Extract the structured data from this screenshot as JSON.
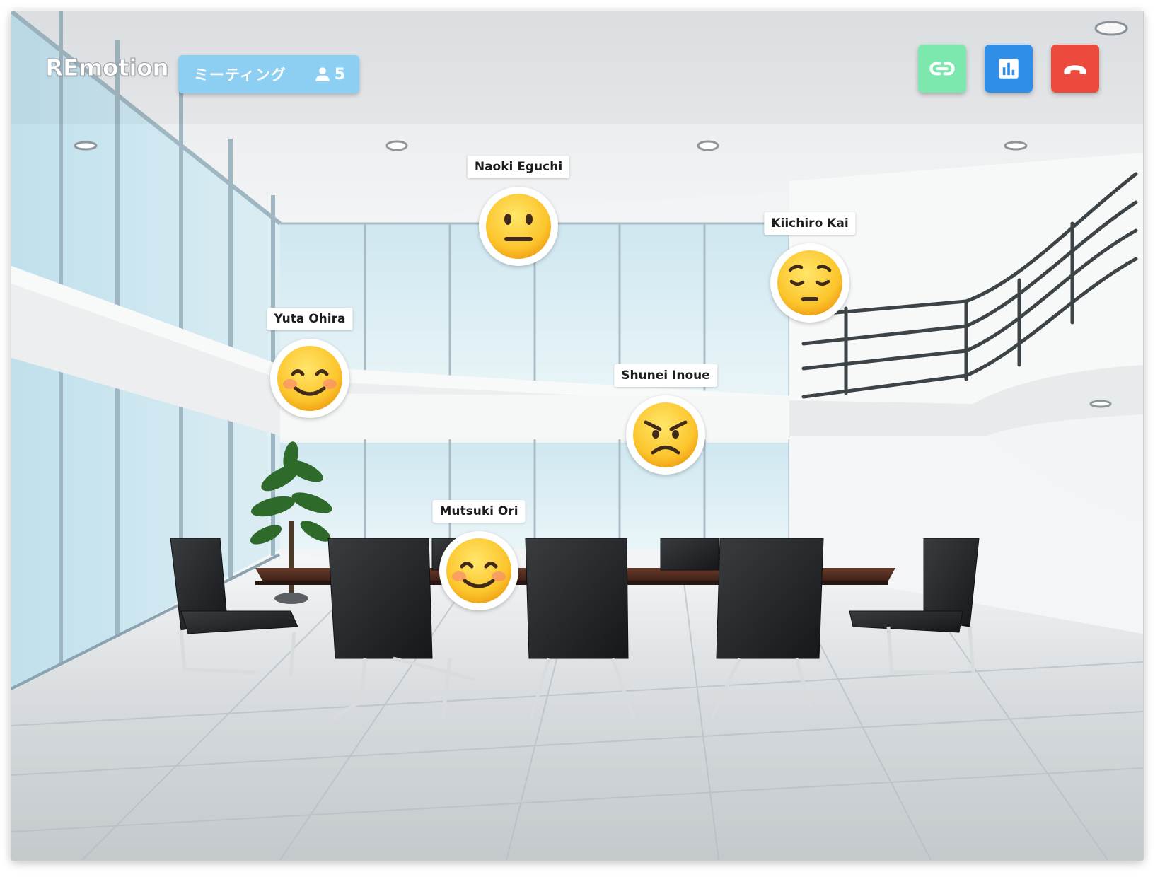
{
  "app": {
    "logo": "REmotion"
  },
  "room": {
    "name": "ミーティング",
    "participant_count": "5",
    "count_icon": "person-icon",
    "color": "#8dcff2"
  },
  "actions": [
    {
      "id": "link",
      "icon": "link-icon",
      "color": "#7de8ad"
    },
    {
      "id": "stats",
      "icon": "bar-chart-icon",
      "color": "#2f8fe8"
    },
    {
      "id": "leave",
      "icon": "phone-hangup-icon",
      "color": "#ec4a3d"
    }
  ],
  "participants": [
    {
      "name": "Naoki Eguchi",
      "emotion": "neutral"
    },
    {
      "name": "Kiichiro Kai",
      "emotion": "pensive"
    },
    {
      "name": "Yuta Ohira",
      "emotion": "smiling"
    },
    {
      "name": "Shunei Inoue",
      "emotion": "angry"
    },
    {
      "name": "Mutsuki Ori",
      "emotion": "smiling"
    }
  ],
  "background": "meeting-room-scene"
}
